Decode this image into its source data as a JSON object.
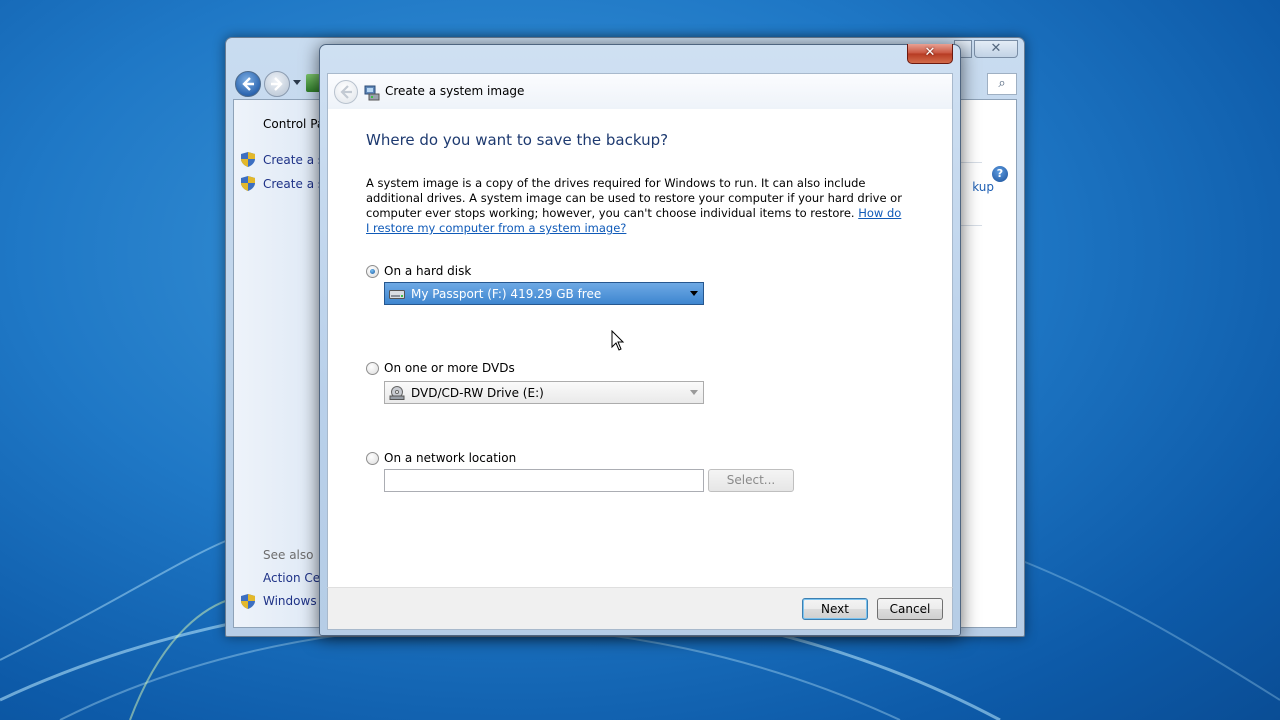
{
  "background_window": {
    "close_glyph": "✕",
    "search_glyph": "⌕",
    "help_glyph": "?",
    "nav_links": [
      "Control Pa",
      "Create a sy",
      "Create a sy"
    ],
    "see_also_label": "See also",
    "see_also_links": [
      "Action Cer",
      "Windows E"
    ],
    "right_link": "kup"
  },
  "dialog": {
    "close_glyph": "✕",
    "title": "Create a system image",
    "heading": "Where do you want to save the backup?",
    "description": "A system image is a copy of the drives required for Windows to run. It can also include additional drives. A system image can be used to restore your computer if your hard drive or computer ever stops working; however, you can't choose individual items to restore. ",
    "help_link": "How do I restore my computer from a system image?",
    "options": {
      "hard_disk": {
        "label": "On a hard disk",
        "checked": true,
        "selected_value": "My Passport (F:)  419.29 GB free"
      },
      "dvd": {
        "label": "On one or more DVDs",
        "checked": false,
        "selected_value": "DVD/CD-RW Drive (E:)"
      },
      "network": {
        "label": "On a network location",
        "checked": false,
        "input_value": "",
        "select_label": "Select..."
      }
    },
    "buttons": {
      "next": "Next",
      "cancel": "Cancel"
    }
  },
  "colors": {
    "heading": "#1e3a70",
    "link": "#0f5ab8",
    "close_button": "#c8533d",
    "desktop": "#1f78c6"
  }
}
